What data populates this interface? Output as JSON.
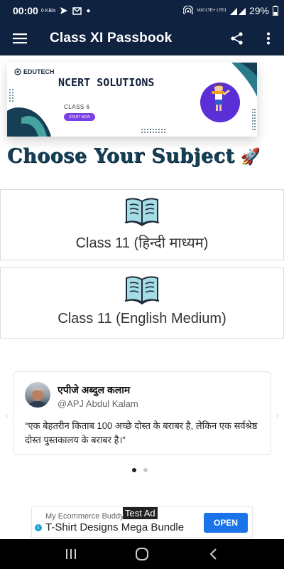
{
  "status_bar": {
    "time": "00:00",
    "kbs": "0 KB/s",
    "network": "Vo0 LTE+ LTE1",
    "battery": "29%"
  },
  "app_bar": {
    "title": "Class XI Passbook",
    "menu_icon": "hamburger-menu-icon",
    "share_icon": "share-icon",
    "more_icon": "more-vertical-icon"
  },
  "banner": {
    "brand": "EDUTECH",
    "title": "NCERT SOLUTIONS",
    "subtitle": "CLASS 6",
    "button": "START NOW"
  },
  "heading": {
    "text": "Choose Your Subject",
    "emoji": "🚀"
  },
  "subjects": [
    {
      "label": "Class 11 (हिन्दी माध्यम)",
      "icon": "book-icon"
    },
    {
      "label": "Class 11 (English Medium)",
      "icon": "book-icon"
    }
  ],
  "quote": {
    "author": "एपीजे अब्दुल कलाम",
    "handle": "@APJ Abdul Kalam",
    "text": "“एक बेहतरीन किताब 100 अच्छे दोस्त के बराबर है, लेकिन एक सर्वश्रेष्ठ दोस्त पुस्तकालय के बराबर है।”"
  },
  "carousel": {
    "pages": 2,
    "active": 1
  },
  "ad": {
    "tag": "Test Ad",
    "advertiser": "My Ecommerce Buddy",
    "title": "T-Shirt Designs Mega Bundle",
    "cta": "OPEN"
  },
  "colors": {
    "app_bar": "#0f2240",
    "heading": "#163f56",
    "ad_button": "#1a73e8"
  }
}
